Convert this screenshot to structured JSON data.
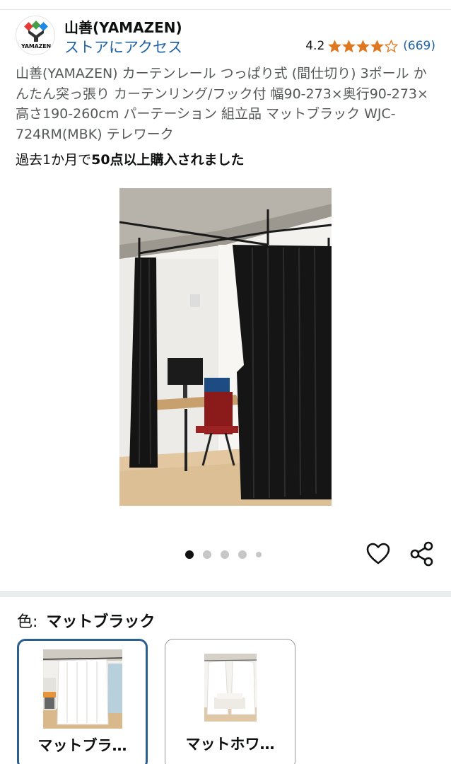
{
  "brand": {
    "logo_text": "YAMAZEN",
    "name": "山善(YAMAZEN)",
    "store_link": "ストアにアクセス"
  },
  "rating": {
    "value": "4.2",
    "stars": 4.2,
    "count": "(669)",
    "star_color": "#de7921"
  },
  "product": {
    "title": "山善(YAMAZEN) カーテンレール つっぱり式 (間仕切り) 3ポール かんたん突っ張り カーテンリング/フック付 幅90-273×奥行90-273×高さ190-260cm パーテーション 組立品 マットブラック WJC-724RM(MBK) テレワーク",
    "purchase_prefix": "過去1か月で",
    "purchase_bold": "50点以上購入されました"
  },
  "gallery": {
    "image_count": 5,
    "active_index": 0,
    "icons": [
      "heart-icon",
      "share-icon"
    ]
  },
  "color_selector": {
    "key": "色:",
    "selected": "マットブラック",
    "options": [
      {
        "label": "マットブラ…",
        "selected": true
      },
      {
        "label": "マットホワ…",
        "selected": false
      }
    ]
  },
  "colors": {
    "link": "#2162a1",
    "selected_border": "#2b5f8f"
  }
}
